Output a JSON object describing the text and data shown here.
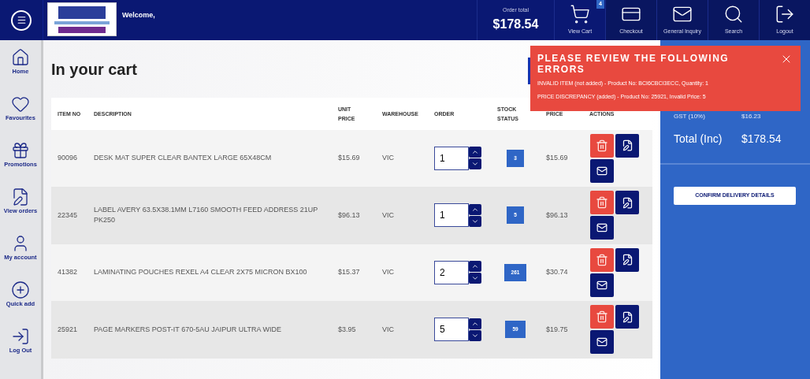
{
  "header": {
    "welcome": "Welcome,",
    "order_total_label": "Order total",
    "order_total": "$178.54",
    "nav": [
      {
        "label": "View Cart",
        "badge": "4",
        "selected": true
      },
      {
        "label": "Checkout",
        "selected": false
      },
      {
        "label": "General Inquiry",
        "selected": false
      },
      {
        "label": "Search",
        "selected": false
      },
      {
        "label": "Logout",
        "selected": false
      }
    ]
  },
  "sidebar": {
    "items": [
      {
        "label": "Home"
      },
      {
        "label": "Favourites"
      },
      {
        "label": "Promotions"
      },
      {
        "label": "View orders"
      },
      {
        "label": "My account"
      },
      {
        "label": "Quick add"
      },
      {
        "label": "Log Out"
      }
    ]
  },
  "page_title": "In your cart",
  "table": {
    "columns": [
      "ITEM NO",
      "DESCRIPTION",
      "UNIT PRICE",
      "WAREHOUSE",
      "ORDER",
      "STOCK STATUS",
      "PRICE",
      "ACTIONS"
    ],
    "rows": [
      {
        "item_no": "90096",
        "description": "DESK MAT SUPER CLEAR BANTEX LARGE 65X48CM",
        "unit_price": "$15.69",
        "warehouse": "VIC",
        "order": "1",
        "stock": "3",
        "total_price": "$15.69"
      },
      {
        "item_no": "22345",
        "description": "LABEL AVERY 63.5X38.1MM L7160 SMOOTH FEED ADDRESS 21UP PK250",
        "unit_price": "$96.13",
        "warehouse": "VIC",
        "order": "1",
        "stock": "5",
        "total_price": "$96.13"
      },
      {
        "item_no": "41382",
        "description": "LAMINATING POUCHES REXEL A4 CLEAR 2X75 MICRON BX100",
        "unit_price": "$15.37",
        "warehouse": "VIC",
        "order": "2",
        "stock": "261",
        "total_price": "$30.74"
      },
      {
        "item_no": "25921",
        "description": "PAGE MARKERS POST-IT 670-5AU JAIPUR ULTRA WIDE",
        "unit_price": "$3.95",
        "warehouse": "VIC",
        "order": "5",
        "stock": "59",
        "total_price": "$19.75"
      }
    ]
  },
  "summary": {
    "gst_label": "GST (10%)",
    "gst": "$16.23",
    "total_label": "Total (Inc)",
    "total": "$178.54",
    "confirm_button": "CONFIRM DELIVERY DETAILS"
  },
  "error_toast": {
    "title": "PLEASE REVIEW THE FOLLOWING ERRORS",
    "messages": [
      "INVALID ITEM (not added) - Product No: BCI6CBCI3ECC, Quantity: 1",
      "PRICE DISCREPANCY (added) - Product No: 25921, Invalid Price: 5"
    ]
  }
}
